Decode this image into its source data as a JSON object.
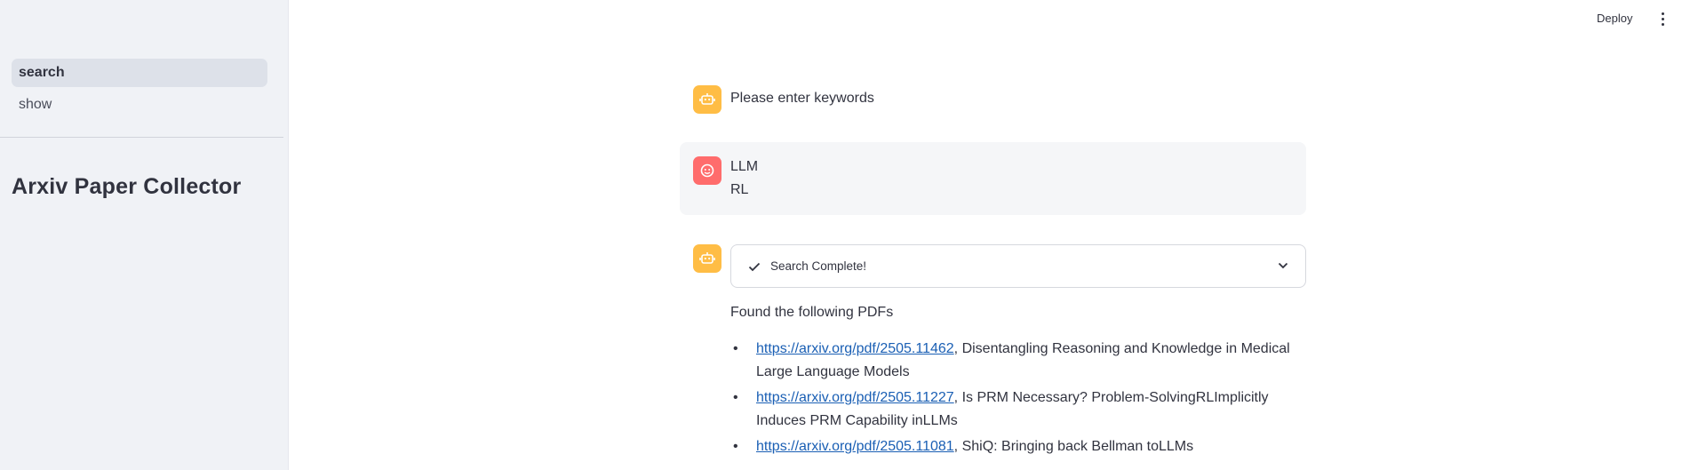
{
  "sidebar": {
    "nav": [
      {
        "label": "search",
        "active": true
      },
      {
        "label": "show",
        "active": false
      }
    ],
    "title": "Arxiv Paper Collector"
  },
  "header": {
    "deploy_label": "Deploy",
    "menu_icon": "kebab-menu-icon"
  },
  "chat": {
    "assistant_prompt": "Please enter keywords",
    "user_message": {
      "line1": "LLM",
      "line2": "RL"
    },
    "status": {
      "label": "Search Complete!",
      "icon": "check-icon",
      "toggle_icon": "chevron-down-icon"
    },
    "found_label": "Found the following PDFs",
    "pdfs": [
      {
        "url": "https://arxiv.org/pdf/2505.11462",
        "title": ", Disentangling Reasoning and Knowledge in Medical Large Language Models"
      },
      {
        "url": "https://arxiv.org/pdf/2505.11227",
        "title": ", Is PRM Necessary? Problem-SolvingRLImplicitly Induces PRM Capability inLLMs"
      },
      {
        "url": "https://arxiv.org/pdf/2505.11081",
        "title": ", ShiQ: Bringing back Bellman toLLMs"
      }
    ]
  },
  "colors": {
    "assistant_avatar": "#ffbd45",
    "user_avatar": "#ff6c6c",
    "link": "#1a5fb4",
    "sidebar_bg": "#f0f2f6"
  }
}
